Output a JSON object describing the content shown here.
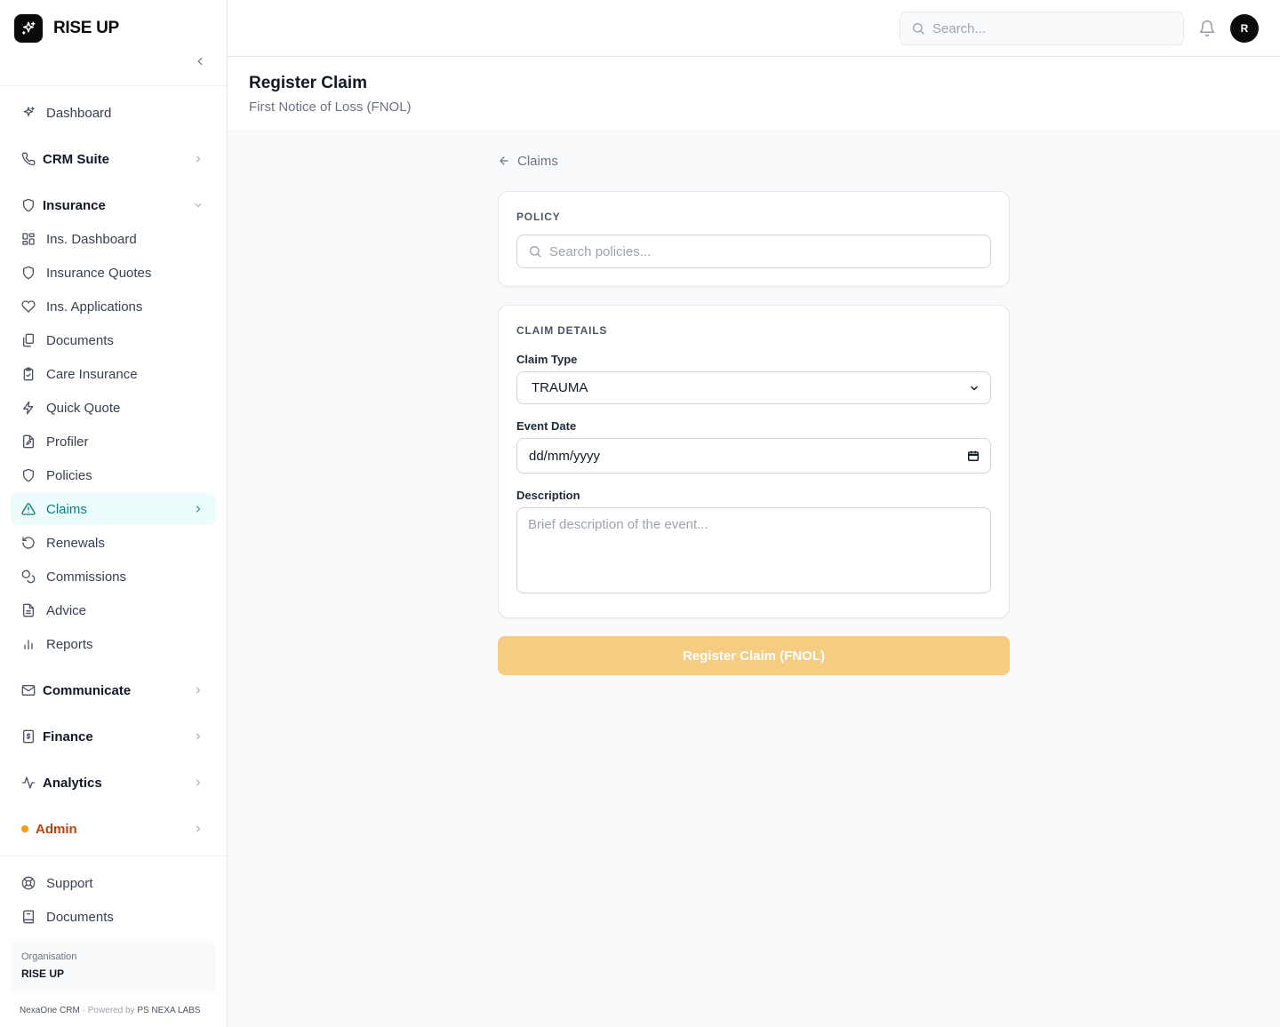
{
  "brand": {
    "name": "RISE UP"
  },
  "topbar": {
    "search_placeholder": "Search...",
    "avatar_initial": "R"
  },
  "sidebar": {
    "items": [
      {
        "label": "Dashboard"
      },
      {
        "label": "CRM Suite"
      },
      {
        "label": "Insurance"
      },
      {
        "label": "Ins. Dashboard"
      },
      {
        "label": "Insurance Quotes"
      },
      {
        "label": "Ins. Applications"
      },
      {
        "label": "Documents"
      },
      {
        "label": "Care Insurance"
      },
      {
        "label": "Quick Quote"
      },
      {
        "label": "Profiler"
      },
      {
        "label": "Policies"
      },
      {
        "label": "Claims"
      },
      {
        "label": "Renewals"
      },
      {
        "label": "Commissions"
      },
      {
        "label": "Advice"
      },
      {
        "label": "Reports"
      },
      {
        "label": "Communicate"
      },
      {
        "label": "Finance"
      },
      {
        "label": "Analytics"
      },
      {
        "label": "Admin"
      },
      {
        "label": "Support"
      },
      {
        "label": "Documents"
      }
    ],
    "org_label": "Organisation",
    "org_name": "RISE UP",
    "footer_app": "NexaOne CRM",
    "footer_sep": "·",
    "footer_powered": "Powered by",
    "footer_company": "PS NEXA LABS"
  },
  "page": {
    "title": "Register Claim",
    "subtitle": "First Notice of Loss (FNOL)"
  },
  "breadcrumb": {
    "back_label": "Claims"
  },
  "policy_card": {
    "title": "POLICY",
    "search_placeholder": "Search policies..."
  },
  "claim_card": {
    "title": "CLAIM DETAILS",
    "claim_type_label": "Claim Type",
    "claim_type_value": "TRAUMA",
    "event_date_label": "Event Date",
    "event_date_value": "dd/mm/yyyy",
    "description_label": "Description",
    "description_placeholder": "Brief description of the event..."
  },
  "submit": {
    "label": "Register Claim (FNOL)"
  },
  "colors": {
    "accent": "#0e7c86",
    "active_bg": "#ecfbfb",
    "submit_bg": "#f6cb82",
    "admin": "#c2410c",
    "admin_dot": "#f59e0b"
  }
}
